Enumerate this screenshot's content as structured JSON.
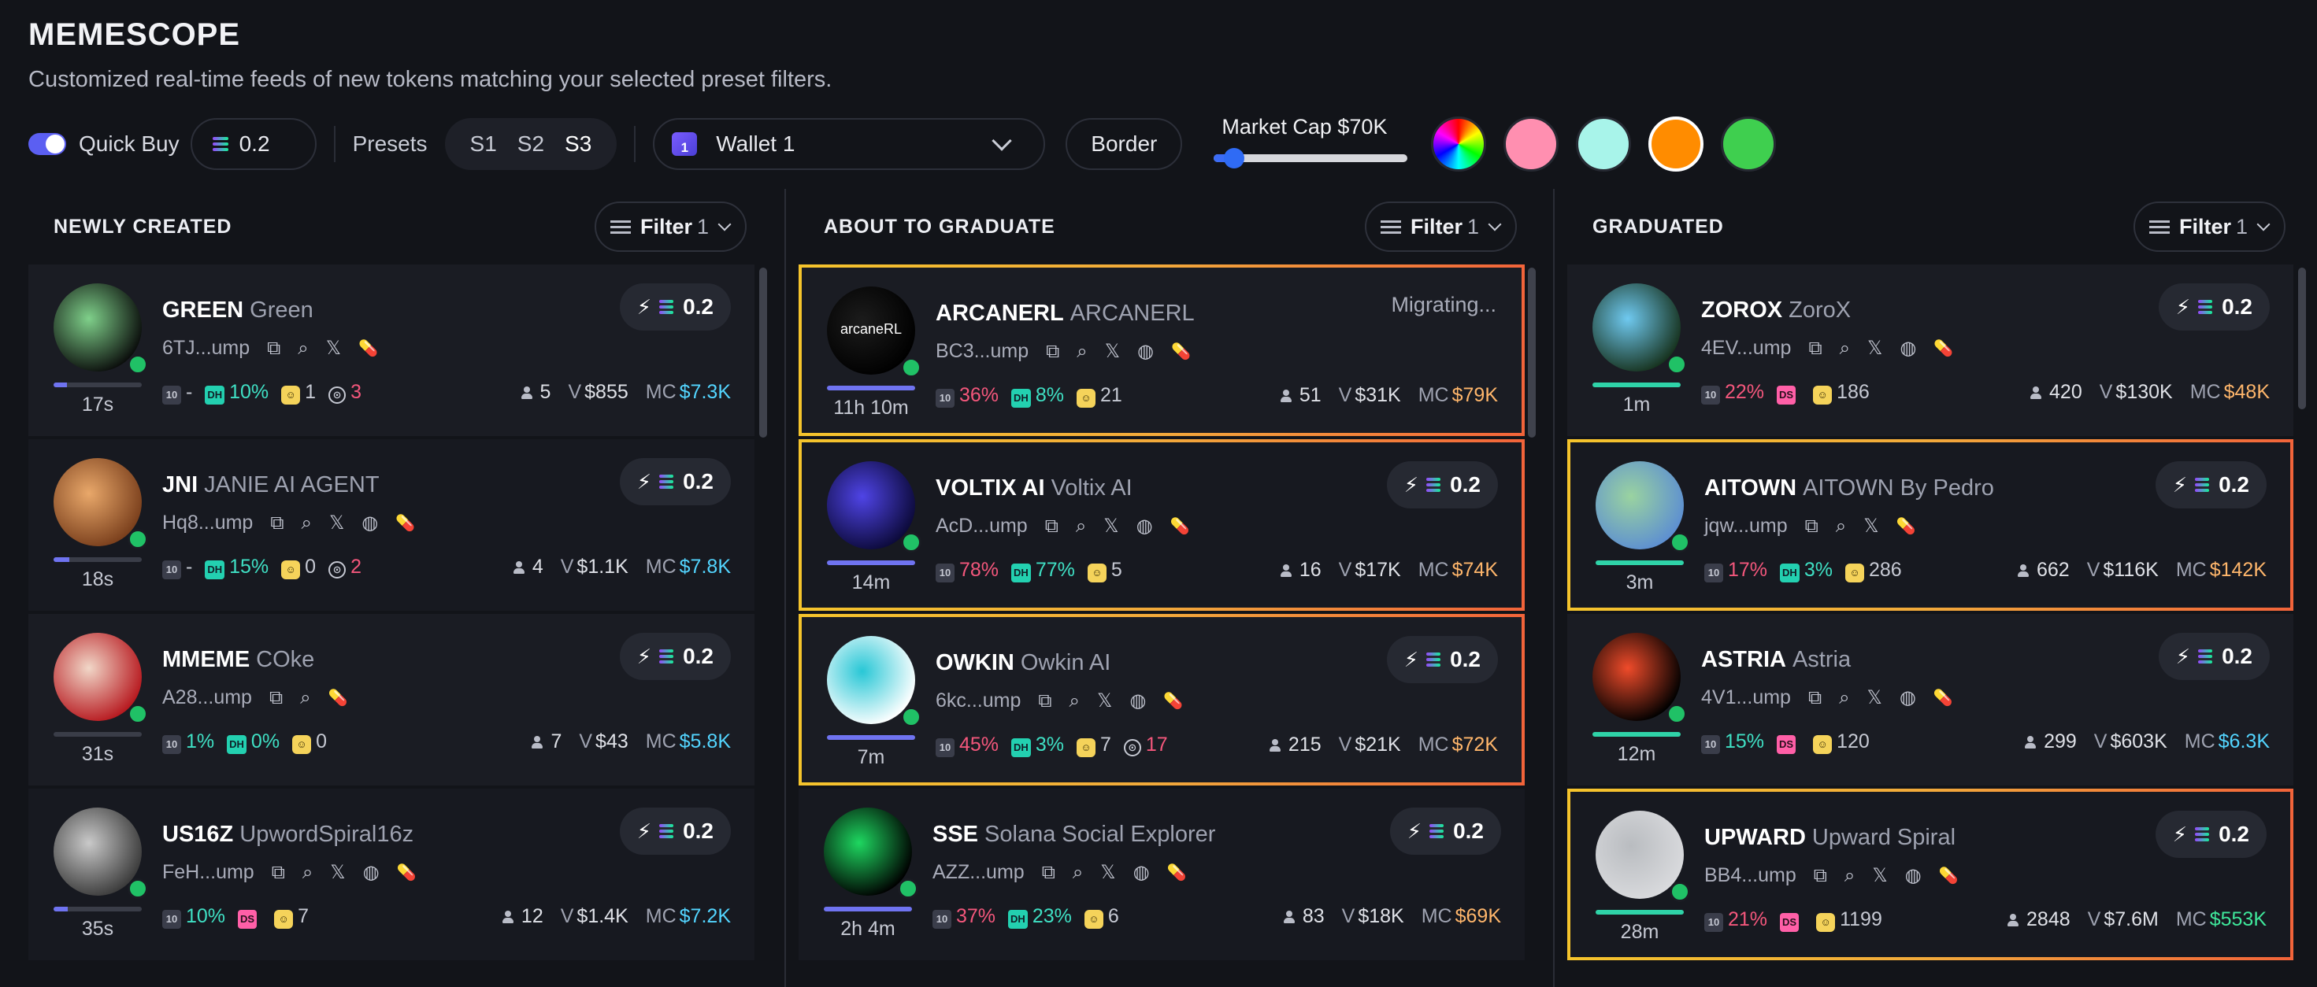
{
  "header": {
    "title": "MEMESCOPE",
    "subtitle": "Customized real-time feeds of new tokens matching your selected preset filters."
  },
  "controls": {
    "quick_buy_label": "Quick Buy",
    "quick_buy_enabled": true,
    "amount": "0.2",
    "presets_label": "Presets",
    "presets": [
      "S1",
      "S2",
      "S3"
    ],
    "active_preset": "S3",
    "wallet_badge": "1",
    "wallet": "Wallet 1",
    "border_label": "Border",
    "market_cap_label": "Market Cap $70K",
    "market_cap_slider_level": 0.05,
    "swatches": [
      {
        "name": "rainbow",
        "color": "conic-gradient(red, yellow, lime, cyan, blue, magenta, red)"
      },
      {
        "name": "pink",
        "color": "#ff8fb0"
      },
      {
        "name": "mint",
        "color": "#a8f4ea"
      },
      {
        "name": "orange",
        "color": "#ff8c00",
        "selected": true
      },
      {
        "name": "green",
        "color": "#3fcf4f"
      }
    ]
  },
  "columns": [
    {
      "title": "NEWLY CREATED",
      "filter_label": "Filter",
      "filter_count": "1",
      "tokens": [
        {
          "ticker": "GREEN",
          "name": "Green",
          "address": "6TJ...ump",
          "age": "17s",
          "progress": 0.15,
          "socials": [
            "x"
          ],
          "avatar_colors": [
            "#0b0e0c",
            "#7fd08a"
          ],
          "stats": [
            {
              "tag": "10",
              "cls": "t10",
              "value": "-",
              "color": "gray"
            },
            {
              "tag": "DH",
              "cls": "dh",
              "value": "10%",
              "color": "teal"
            },
            {
              "tag": "☺",
              "cls": "face",
              "value": "1",
              "color": "gray"
            },
            {
              "tag": "⊙",
              "cls": "tgt",
              "value": "3",
              "color": "red"
            }
          ],
          "holders": "5",
          "volume": "$855",
          "mc": "$7.3K",
          "mc_color": "cyan",
          "buy": "0.2"
        },
        {
          "ticker": "JNI",
          "name": "JANIE AI AGENT",
          "address": "Hq8...ump",
          "age": "18s",
          "progress": 0.18,
          "socials": [
            "x",
            "web"
          ],
          "avatar_colors": [
            "#7a3f1c",
            "#e9a86a"
          ],
          "stats": [
            {
              "tag": "10",
              "cls": "t10",
              "value": "-",
              "color": "gray"
            },
            {
              "tag": "DH",
              "cls": "dh",
              "value": "15%",
              "color": "teal"
            },
            {
              "tag": "☺",
              "cls": "face",
              "value": "0",
              "color": "gray"
            },
            {
              "tag": "⊙",
              "cls": "tgt",
              "value": "2",
              "color": "red"
            }
          ],
          "holders": "4",
          "volume": "$1.1K",
          "mc": "$7.8K",
          "mc_color": "cyan",
          "buy": "0.2"
        },
        {
          "ticker": "MMEME",
          "name": "COke",
          "address": "A28...ump",
          "age": "31s",
          "progress": 0.0,
          "socials": [],
          "avatar_colors": [
            "#b7191f",
            "#f1d7c8"
          ],
          "stats": [
            {
              "tag": "10",
              "cls": "t10",
              "value": "1%",
              "color": "teal"
            },
            {
              "tag": "DH",
              "cls": "dh",
              "value": "0%",
              "color": "teal"
            },
            {
              "tag": "☺",
              "cls": "face",
              "value": "0",
              "color": "gray"
            }
          ],
          "holders": "7",
          "volume": "$43",
          "mc": "$5.8K",
          "mc_color": "cyan",
          "buy": "0.2"
        },
        {
          "ticker": "US16Z",
          "name": "UpwordSpiral16z",
          "address": "FeH...ump",
          "age": "35s",
          "progress": 0.16,
          "socials": [
            "x",
            "web"
          ],
          "avatar_colors": [
            "#3b3b3b",
            "#c9c9c9"
          ],
          "stats": [
            {
              "tag": "10",
              "cls": "t10",
              "value": "10%",
              "color": "teal"
            },
            {
              "tag": "DS",
              "cls": "ds",
              "value": "",
              "color": "gray"
            },
            {
              "tag": "☺",
              "cls": "face",
              "value": "7",
              "color": "gray"
            }
          ],
          "holders": "12",
          "volume": "$1.4K",
          "mc": "$7.2K",
          "mc_color": "cyan",
          "buy": "0.2"
        }
      ]
    },
    {
      "title": "ABOUT TO GRADUATE",
      "filter_label": "Filter",
      "filter_count": "1",
      "tokens": [
        {
          "ticker": "ARCANERL",
          "name": "ARCANERL",
          "address": "BC3...ump",
          "age": "11h 10m",
          "progress": 1.0,
          "socials": [
            "x",
            "web"
          ],
          "avatar_colors": [
            "#000000",
            "#1c1c1c"
          ],
          "avatar_text": "arcaneRL",
          "status": "Migrating...",
          "highlight": true,
          "stats": [
            {
              "tag": "10",
              "cls": "t10",
              "value": "36%",
              "color": "red"
            },
            {
              "tag": "DH",
              "cls": "dh",
              "value": "8%",
              "color": "teal"
            },
            {
              "tag": "☺",
              "cls": "face",
              "value": "21",
              "color": "gray"
            }
          ],
          "holders": "51",
          "volume": "$31K",
          "mc": "$79K",
          "mc_color": "orange",
          "buy": ""
        },
        {
          "ticker": "VOLTIX AI",
          "name": "Voltix AI",
          "address": "AcD...ump",
          "age": "14m",
          "progress": 1.0,
          "socials": [
            "x",
            "web"
          ],
          "avatar_colors": [
            "#0c0a3a",
            "#4f44e6"
          ],
          "highlight": true,
          "stats": [
            {
              "tag": "10",
              "cls": "t10",
              "value": "78%",
              "color": "red"
            },
            {
              "tag": "DH",
              "cls": "dh",
              "value": "77%",
              "color": "teal"
            },
            {
              "tag": "☺",
              "cls": "face",
              "value": "5",
              "color": "gray"
            }
          ],
          "holders": "16",
          "volume": "$17K",
          "mc": "$74K",
          "mc_color": "orange",
          "buy": "0.2"
        },
        {
          "ticker": "OWKIN",
          "name": "Owkin AI",
          "address": "6kc...ump",
          "age": "7m",
          "progress": 1.0,
          "socials": [
            "x",
            "web"
          ],
          "avatar_colors": [
            "#ffffff",
            "#28c7d6"
          ],
          "highlight": true,
          "stats": [
            {
              "tag": "10",
              "cls": "t10",
              "value": "45%",
              "color": "red"
            },
            {
              "tag": "DH",
              "cls": "dh",
              "value": "3%",
              "color": "teal"
            },
            {
              "tag": "☺",
              "cls": "face",
              "value": "7",
              "color": "gray"
            },
            {
              "tag": "⊙",
              "cls": "tgt",
              "value": "17",
              "color": "red"
            }
          ],
          "holders": "215",
          "volume": "$21K",
          "mc": "$72K",
          "mc_color": "orange",
          "buy": "0.2"
        },
        {
          "ticker": "SSE",
          "name": "Solana Social Explorer",
          "address": "AZZ...ump",
          "age": "2h 4m",
          "progress": 1.0,
          "socials": [
            "x",
            "web"
          ],
          "avatar_colors": [
            "#000000",
            "#1ed760"
          ],
          "stats": [
            {
              "tag": "10",
              "cls": "t10",
              "value": "37%",
              "color": "red"
            },
            {
              "tag": "DH",
              "cls": "dh",
              "value": "23%",
              "color": "teal"
            },
            {
              "tag": "☺",
              "cls": "face",
              "value": "6",
              "color": "gray"
            }
          ],
          "holders": "83",
          "volume": "$18K",
          "mc": "$69K",
          "mc_color": "orange",
          "buy": "0.2"
        }
      ]
    },
    {
      "title": "GRADUATED",
      "filter_label": "Filter",
      "filter_count": "1",
      "tokens": [
        {
          "ticker": "ZOROX",
          "name": "ZoroX",
          "address": "4EV...ump",
          "age": "1m",
          "progress": 1.0,
          "bar_color": "#2fd3a8",
          "socials": [
            "x",
            "web"
          ],
          "avatar_colors": [
            "#17331f",
            "#6fc9f0"
          ],
          "stats": [
            {
              "tag": "10",
              "cls": "t10",
              "value": "22%",
              "color": "red"
            },
            {
              "tag": "DS",
              "cls": "ds",
              "value": "",
              "color": "gray"
            },
            {
              "tag": "☺",
              "cls": "face",
              "value": "186",
              "color": "gray"
            }
          ],
          "holders": "420",
          "volume": "$130K",
          "mc": "$48K",
          "mc_color": "orange",
          "buy": "0.2"
        },
        {
          "ticker": "AITOWN",
          "name": "AITOWN By Pedro",
          "address": "jqw...ump",
          "age": "3m",
          "progress": 1.0,
          "bar_color": "#2fd3a8",
          "socials": [
            "x"
          ],
          "avatar_colors": [
            "#5d8fd1",
            "#9ad3a0"
          ],
          "highlight": true,
          "stats": [
            {
              "tag": "10",
              "cls": "t10",
              "value": "17%",
              "color": "red"
            },
            {
              "tag": "DH",
              "cls": "dh",
              "value": "3%",
              "color": "teal"
            },
            {
              "tag": "☺",
              "cls": "face",
              "value": "286",
              "color": "gray"
            }
          ],
          "holders": "662",
          "volume": "$116K",
          "mc": "$142K",
          "mc_color": "orange",
          "buy": "0.2"
        },
        {
          "ticker": "ASTRIA",
          "name": "Astria",
          "address": "4V1...ump",
          "age": "12m",
          "progress": 1.0,
          "bar_color": "#2fd3a8",
          "socials": [
            "x",
            "web"
          ],
          "avatar_colors": [
            "#000000",
            "#ef4b2a"
          ],
          "stats": [
            {
              "tag": "10",
              "cls": "t10",
              "value": "15%",
              "color": "teal"
            },
            {
              "tag": "DS",
              "cls": "ds",
              "value": "",
              "color": "gray"
            },
            {
              "tag": "☺",
              "cls": "face",
              "value": "120",
              "color": "gray"
            }
          ],
          "holders": "299",
          "volume": "$603K",
          "mc": "$6.3K",
          "mc_color": "cyan",
          "buy": "0.2"
        },
        {
          "ticker": "UPWARD",
          "name": "Upward Spiral",
          "address": "BB4...ump",
          "age": "28m",
          "progress": 1.0,
          "bar_color": "#2fd3a8",
          "socials": [
            "x",
            "web"
          ],
          "avatar_colors": [
            "#d9dadd",
            "#b9bcc0"
          ],
          "highlight": true,
          "stats": [
            {
              "tag": "10",
              "cls": "t10",
              "value": "21%",
              "color": "red"
            },
            {
              "tag": "DS",
              "cls": "ds",
              "value": "",
              "color": "gray"
            },
            {
              "tag": "☺",
              "cls": "face",
              "value": "1199",
              "color": "gray"
            }
          ],
          "holders": "2848",
          "volume": "$7.6M",
          "mc": "$553K",
          "mc_color": "green",
          "buy": "0.2"
        }
      ]
    }
  ],
  "labels": {
    "volume_prefix": "V",
    "mc_prefix": "MC"
  }
}
